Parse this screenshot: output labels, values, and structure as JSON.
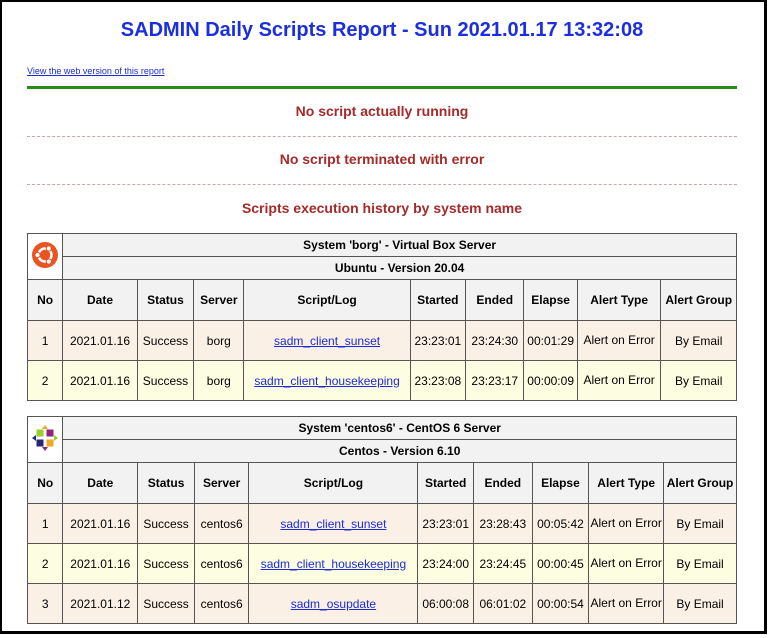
{
  "report": {
    "title": "SADMIN Daily Scripts Report - Sun 2021.01.17 13:32:08",
    "web_link": "View the web version of this report",
    "msg_running": "No script actually running",
    "msg_error": "No script terminated with error",
    "msg_history": "Scripts execution history by system name"
  },
  "columns": [
    "No",
    "Date",
    "Status",
    "Server",
    "Script/Log",
    "Started",
    "Ended",
    "Elapse",
    "Alert Type",
    "Alert Group"
  ],
  "systems": [
    {
      "logo_icon": "ubuntu-logo-icon",
      "title": "System 'borg' - Virtual Box Server",
      "os": "Ubuntu - Version 20.04",
      "rows": [
        {
          "no": "1",
          "date": "2021.01.16",
          "status": "Success",
          "server": "borg",
          "script": "sadm_client_sunset",
          "started": "23:23:01",
          "ended": "23:24:30",
          "elapse": "00:01:29",
          "alert_type": "Alert on Error",
          "alert_group": "By Email"
        },
        {
          "no": "2",
          "date": "2021.01.16",
          "status": "Success",
          "server": "borg",
          "script": "sadm_client_housekeeping",
          "started": "23:23:08",
          "ended": "23:23:17",
          "elapse": "00:00:09",
          "alert_type": "Alert on Error",
          "alert_group": "By Email"
        }
      ]
    },
    {
      "logo_icon": "centos-logo-icon",
      "title": "System 'centos6' - CentOS 6 Server",
      "os": "Centos - Version 6.10",
      "rows": [
        {
          "no": "1",
          "date": "2021.01.16",
          "status": "Success",
          "server": "centos6",
          "script": "sadm_client_sunset",
          "started": "23:23:01",
          "ended": "23:28:43",
          "elapse": "00:05:42",
          "alert_type": "Alert on Error",
          "alert_group": "By Email"
        },
        {
          "no": "2",
          "date": "2021.01.16",
          "status": "Success",
          "server": "centos6",
          "script": "sadm_client_housekeeping",
          "started": "23:24:00",
          "ended": "23:24:45",
          "elapse": "00:00:45",
          "alert_type": "Alert on Error",
          "alert_group": "By Email"
        },
        {
          "no": "3",
          "date": "2021.01.12",
          "status": "Success",
          "server": "centos6",
          "script": "sadm_osupdate",
          "started": "06:00:08",
          "ended": "06:01:02",
          "elapse": "00:00:54",
          "alert_type": "Alert on Error",
          "alert_group": "By Email"
        }
      ]
    }
  ],
  "colors": {
    "title": "#1b2fe0",
    "section": "#a52a2a",
    "divider": "#2c8a1c",
    "ubuntu": "#e95420"
  }
}
